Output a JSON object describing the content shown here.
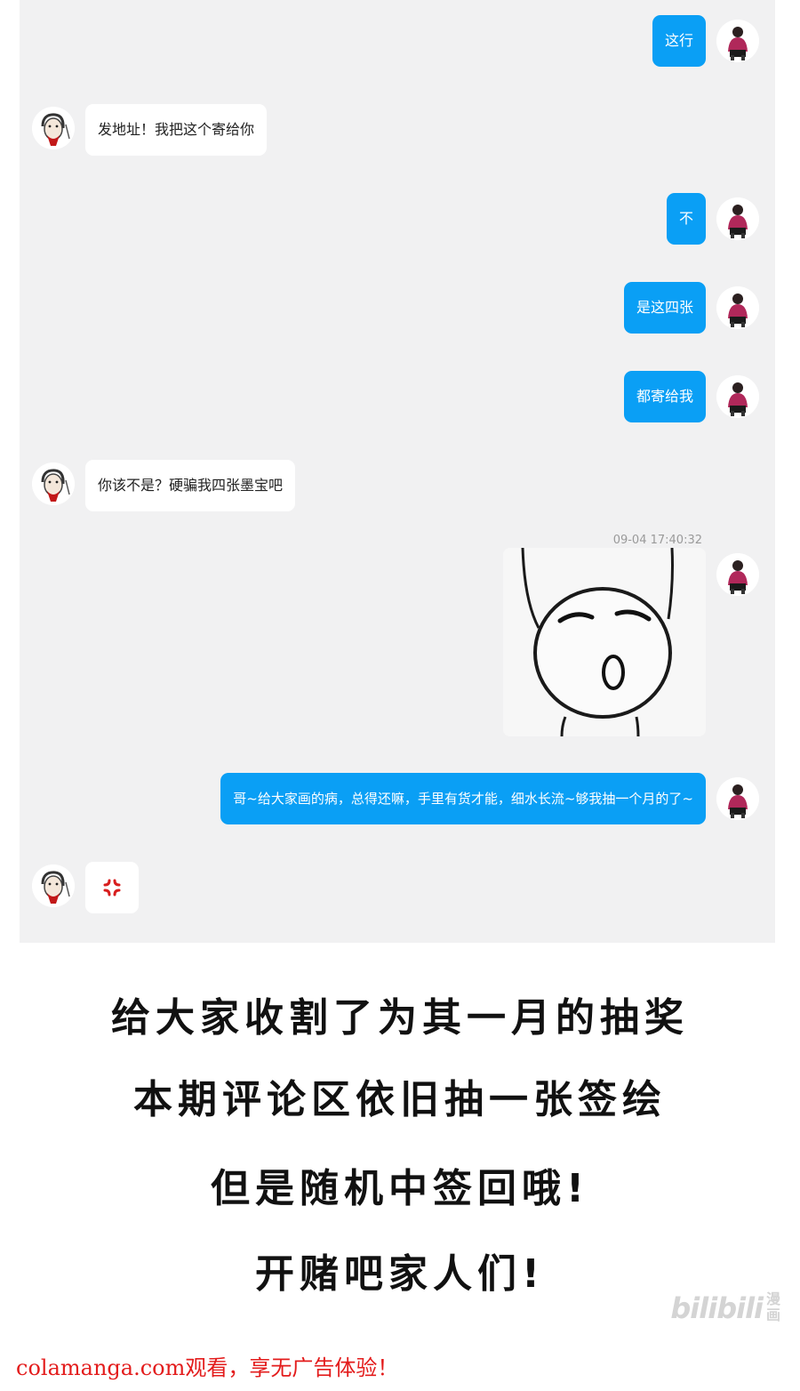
{
  "messages": [
    {
      "side": "out",
      "text": "这行"
    },
    {
      "side": "in",
      "text": "发地址！我把这个寄给你"
    },
    {
      "side": "out",
      "text": "不"
    },
    {
      "side": "out",
      "text": "是这四张"
    },
    {
      "side": "out",
      "text": "都寄给我"
    },
    {
      "side": "in",
      "text": "你该不是？硬骗我四张墨宝吧"
    },
    {
      "side": "out",
      "text": "哥~给大家画的病，总得还嘛，手里有货才能，细水长流~够我抽一个月的了~"
    }
  ],
  "image_message": {
    "timestamp": "09-04 17:40:32",
    "content": "sleepy-face-sticker"
  },
  "reaction_message": {
    "side": "in",
    "icon": "anger-symbol-icon"
  },
  "captions": [
    "给大家收割了为其一月的抽奖",
    "本期评论区依旧抽一张签绘",
    "但是随机中签回哦!",
    "开赌吧家人们!"
  ],
  "watermark": {
    "logo": "bilibili",
    "sub": "漫画"
  },
  "footer": "colamanga.com观看，享无广告体验！",
  "colors": {
    "outgoing_bubble": "#0a9ff5",
    "chat_background": "#f1f1f2",
    "footer_text": "#e31c1c"
  }
}
